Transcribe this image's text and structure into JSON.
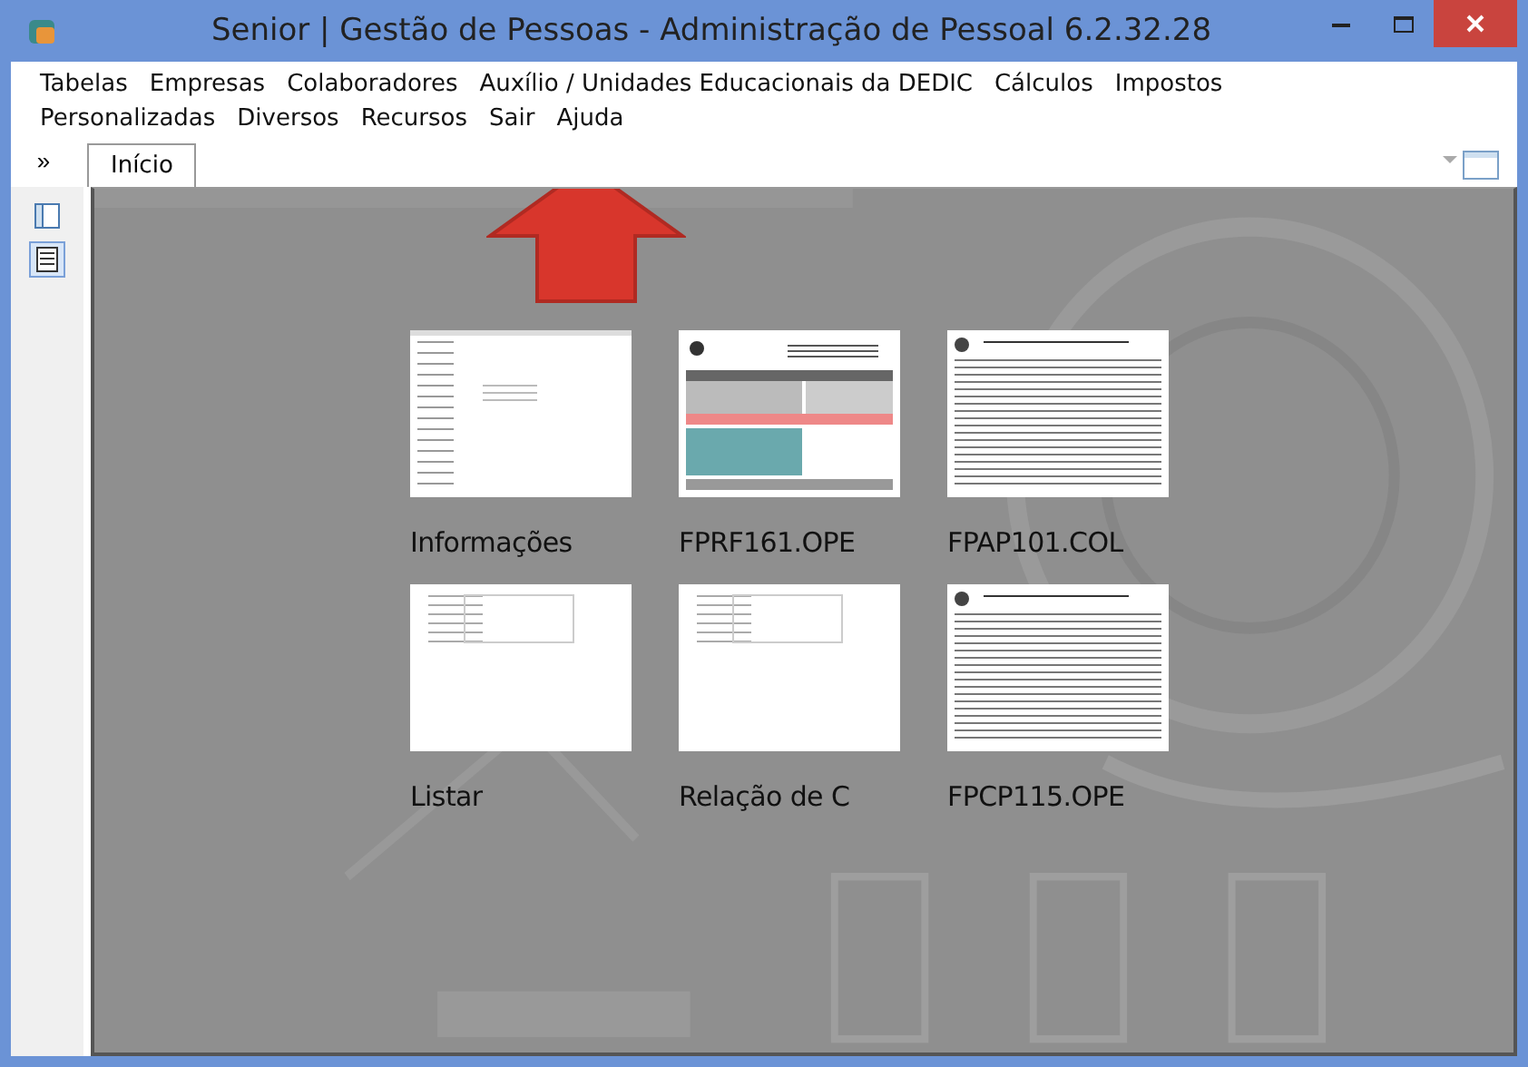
{
  "window": {
    "title": "Senior | Gestão de Pessoas - Administração de Pessoal 6.2.32.28"
  },
  "menu": [
    {
      "label": "Tabelas"
    },
    {
      "label": "Empresas"
    },
    {
      "label": "Colaboradores"
    },
    {
      "label": "Auxílio / Unidades Educacionais da DEDIC"
    },
    {
      "label": "Cálculos"
    },
    {
      "label": "Impostos"
    },
    {
      "label": "Personalizadas"
    },
    {
      "label": "Diversos"
    },
    {
      "label": "Recursos"
    },
    {
      "label": "Sair"
    },
    {
      "label": "Ajuda"
    }
  ],
  "expand_button": "»",
  "tabs": [
    {
      "label": "Início",
      "selected": true
    }
  ],
  "side_tools": [
    {
      "selected": false
    },
    {
      "selected": true
    }
  ],
  "recent_items": [
    {
      "label": "Informações",
      "kind": "form"
    },
    {
      "label": "FPRF161.OPE",
      "kind": "colored"
    },
    {
      "label": "FPAP101.COL",
      "kind": "table"
    },
    {
      "label": "Listar",
      "kind": "blank"
    },
    {
      "label": "Relação de C",
      "kind": "blank"
    },
    {
      "label": "FPCP115.OPE",
      "kind": "table"
    }
  ]
}
